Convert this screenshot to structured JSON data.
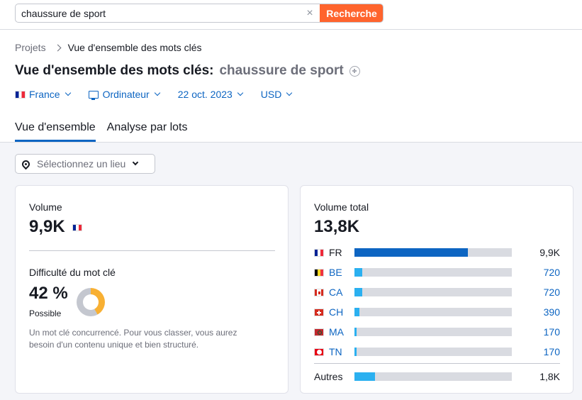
{
  "search": {
    "value": "chaussure de sport",
    "clear_icon": "×",
    "button_label": "Recherche"
  },
  "breadcrumb": {
    "root": "Projets",
    "current": "Vue d'ensemble des mots clés"
  },
  "title": {
    "main": "Vue d'ensemble des mots clés:",
    "keyword": "chaussure de sport"
  },
  "filters": {
    "country": "France",
    "device": "Ordinateur",
    "date": "22 oct. 2023",
    "currency": "USD"
  },
  "tabs": [
    {
      "label": "Vue d'ensemble",
      "active": true
    },
    {
      "label": "Analyse par lots",
      "active": false
    }
  ],
  "location": {
    "placeholder": "Sélectionnez un lieu"
  },
  "volume_card": {
    "volume_label": "Volume",
    "volume_value": "9,9K",
    "kd_label": "Difficulté du mot clé",
    "kd_value": "42 %",
    "kd_percent": 42,
    "kd_rating": "Possible",
    "kd_color": "#f8b033",
    "kd_description": "Un mot clé concurrencé. Pour vous classer, vous aurez besoin d'un contenu unique et bien structuré."
  },
  "total_card": {
    "label": "Volume total",
    "value": "13,8K",
    "rows": [
      {
        "code": "FR",
        "flag": "fr",
        "value": "9,9K",
        "share": 0.72,
        "link": false,
        "color": "#0d65c2"
      },
      {
        "code": "BE",
        "flag": "be",
        "value": "720",
        "share": 0.05,
        "link": true,
        "color": "#2bb0f0"
      },
      {
        "code": "CA",
        "flag": "ca",
        "value": "720",
        "share": 0.05,
        "link": true,
        "color": "#2bb0f0"
      },
      {
        "code": "CH",
        "flag": "ch",
        "value": "390",
        "share": 0.03,
        "link": true,
        "color": "#2bb0f0"
      },
      {
        "code": "MA",
        "flag": "ma",
        "value": "170",
        "share": 0.015,
        "link": true,
        "color": "#2bb0f0"
      },
      {
        "code": "TN",
        "flag": "tn",
        "value": "170",
        "share": 0.015,
        "link": true,
        "color": "#2bb0f0"
      }
    ],
    "other": {
      "label": "Autres",
      "value": "1,8K",
      "share": 0.13,
      "color": "#2bb0f0"
    }
  }
}
